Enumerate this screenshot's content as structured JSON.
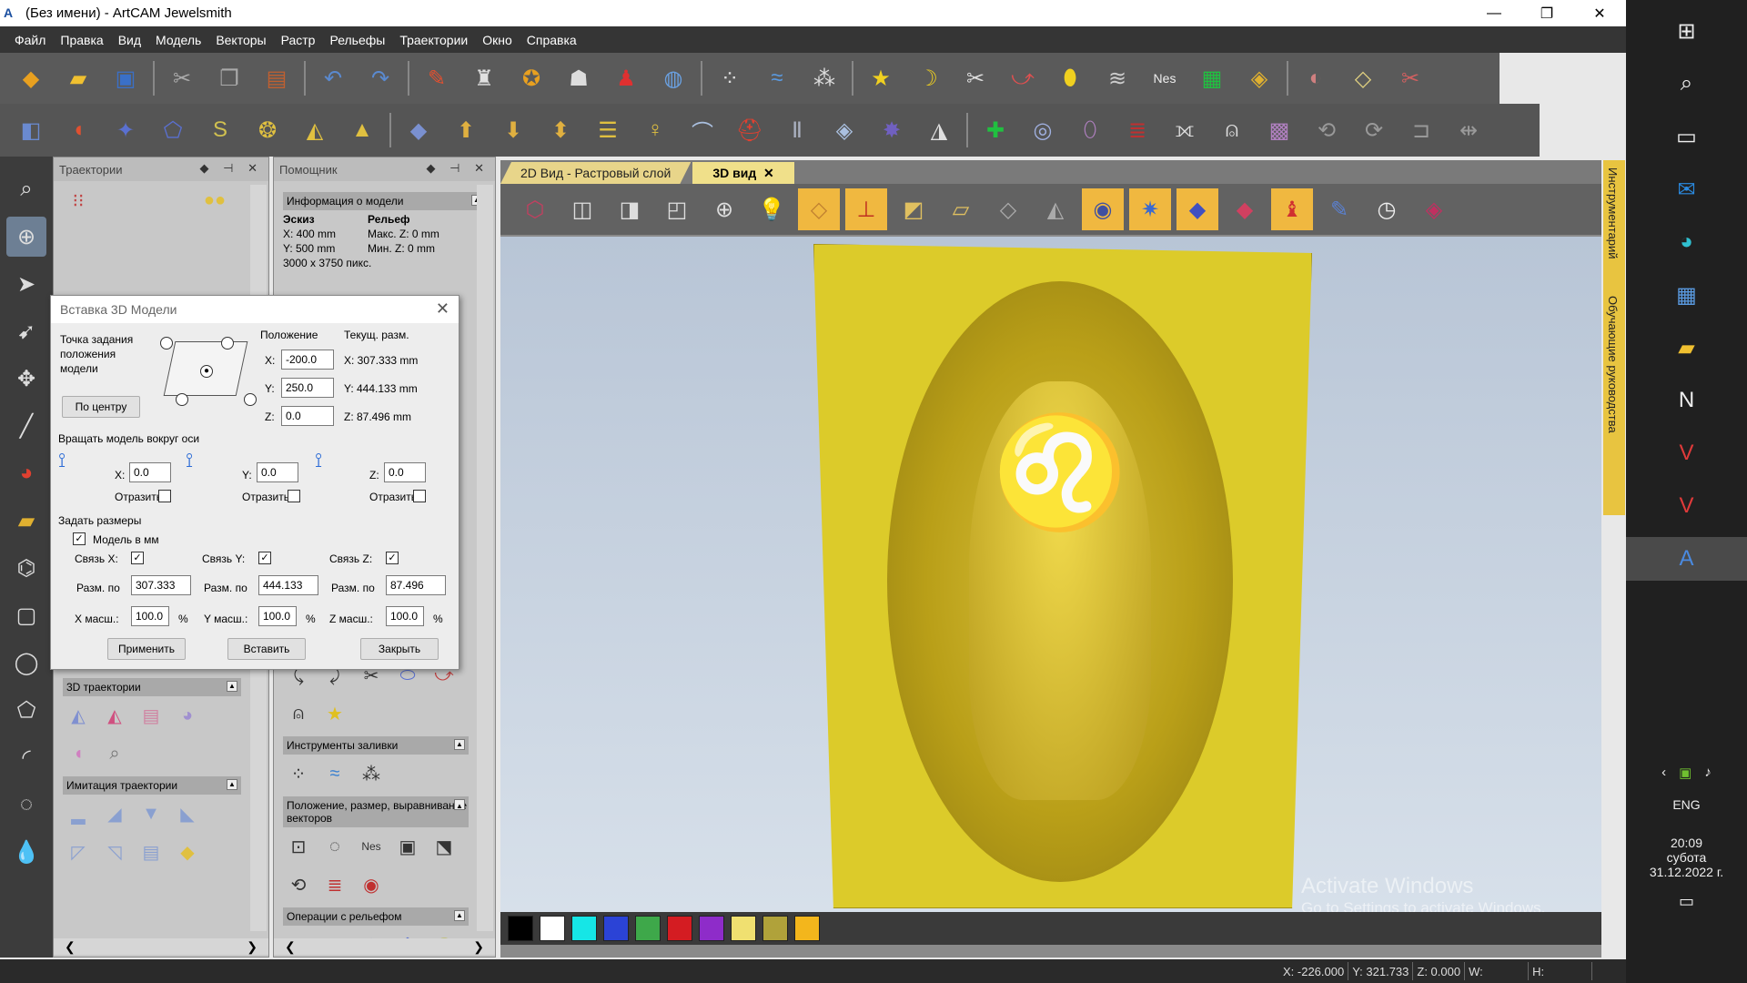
{
  "window": {
    "title": "(Без имени) - ArtCAM Jewelsmith",
    "logo": "A"
  },
  "menu": [
    "Файл",
    "Правка",
    "Вид",
    "Модель",
    "Векторы",
    "Растр",
    "Рельефы",
    "Траектории",
    "Окно",
    "Справка"
  ],
  "panels": {
    "left": {
      "title": "Траектории",
      "sections": [
        "3D траектории",
        "Имитация траектории"
      ]
    },
    "mid": {
      "title": "Помощник",
      "info_title": "Информация о модели",
      "info_col1": "Эскиз",
      "info_col2": "Рельеф",
      "info_x": "X: 400 mm",
      "info_y": "Y: 500 mm",
      "info_maxz": "Макс. Z: 0 mm",
      "info_minz": "Мин. Z: 0 mm",
      "info_px": "3000 x 3750 пикс.",
      "sec_fill": "Инструменты заливки",
      "sec_pos": "Положение, размер, выравнивание векторов",
      "sec_relief": "Операции с рельефом"
    }
  },
  "tabs": {
    "t2d": "2D Вид - Растровый слой",
    "t3d": "3D вид",
    "close": "✕"
  },
  "right_tabs": [
    "Инструментарий",
    "Обучающие руководства"
  ],
  "dialog": {
    "title": "Вставка 3D Модели",
    "anchor_label": "Точка задания положения модели",
    "center_btn": "По центру",
    "pos_header": "Положение",
    "cur_header": "Текущ. разм.",
    "x_label": "X:",
    "y_label": "Y:",
    "z_label": "Z:",
    "pos_x": "-200.0",
    "pos_y": "250.0",
    "pos_z": "0.0",
    "cur_x": "X: 307.333 mm",
    "cur_y": "Y: 444.133 mm",
    "cur_z": "Z: 87.496 mm",
    "rotate_label": "Вращать модель вокруг оси",
    "rot_x": "0.0",
    "rot_y": "0.0",
    "rot_z": "0.0",
    "mirror": "Отразить",
    "size_label": "Задать размеры",
    "mm_label": "Модель в мм",
    "link_x": "Связь X:",
    "link_y": "Связь Y:",
    "link_z": "Связь Z:",
    "size_by": "Разм. по",
    "size_x": "307.333",
    "size_y": "444.133",
    "size_z": "87.496",
    "scale_x_label": "X масш.:",
    "scale_y_label": "Y масш.:",
    "scale_z_label": "Z масш.:",
    "scale_x": "100.0",
    "scale_y": "100.0",
    "scale_z": "100.0",
    "pct": "%",
    "apply": "Применить",
    "insert": "Вставить",
    "close": "Закрыть"
  },
  "viewport": {
    "watermark_title": "Activate Windows",
    "watermark_sub": "Go to Settings to activate Windows."
  },
  "palette": [
    "#000000",
    "#ffffff",
    "#16e6e6",
    "#2b43d6",
    "#3ea84a",
    "#d41c22",
    "#8e2cc9",
    "#f0e070",
    "#b0a23a",
    "#f3b61c"
  ],
  "status": {
    "x": "X: -226.000",
    "y": "Y: 321.733",
    "z": "Z: 0.000",
    "w": "W:",
    "h": "H:"
  },
  "tray": {
    "lang": "ENG",
    "time": "20:09",
    "day": "субота",
    "date": "31.12.2022 г."
  }
}
